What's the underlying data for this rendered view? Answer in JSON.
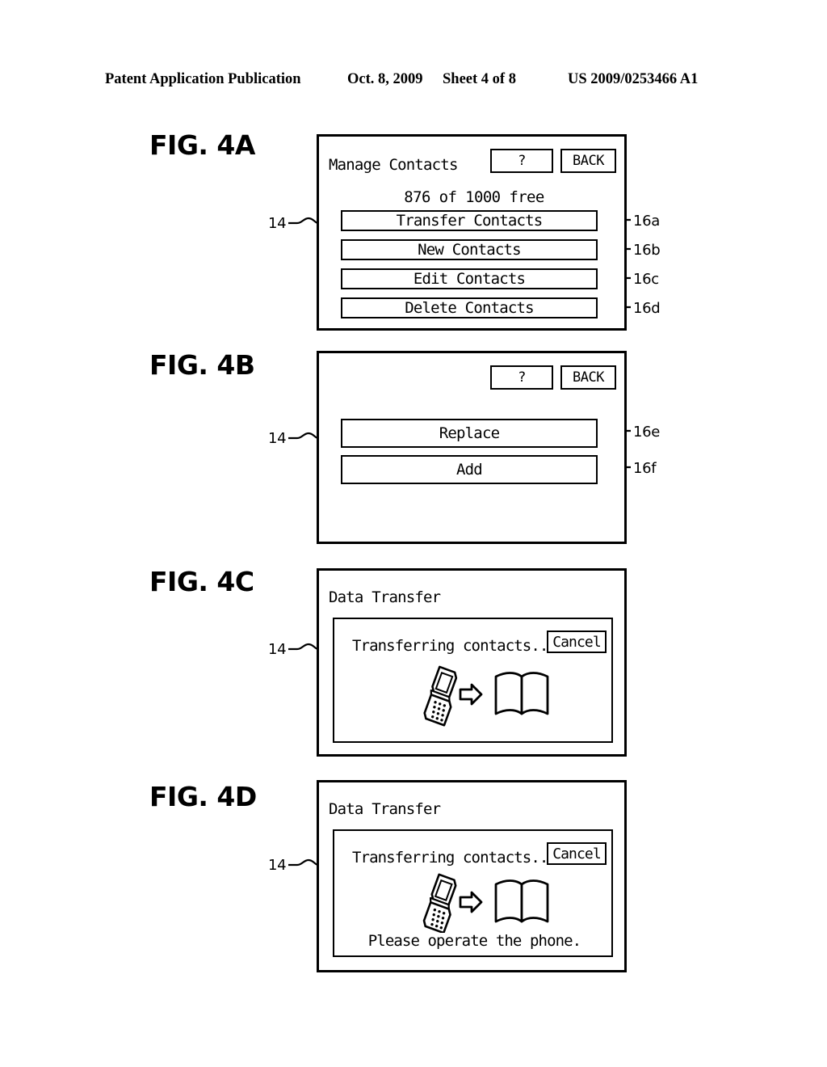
{
  "header": {
    "publication": "Patent Application Publication",
    "date": "Oct. 8, 2009",
    "sheet": "Sheet 4 of 8",
    "patent_number": "US 2009/0253466 A1"
  },
  "figures": [
    {
      "label": "FIG. 4A",
      "screen_ref": "14",
      "title": "Manage Contacts",
      "help_button": "?",
      "back_button": "BACK",
      "free_line": "876 of 1000 free",
      "buttons": [
        {
          "label": "Transfer Contacts",
          "ref": "16a"
        },
        {
          "label": "New Contacts",
          "ref": "16b"
        },
        {
          "label": "Edit Contacts",
          "ref": "16c"
        },
        {
          "label": "Delete Contacts",
          "ref": "16d"
        }
      ]
    },
    {
      "label": "FIG. 4B",
      "screen_ref": "14",
      "help_button": "?",
      "back_button": "BACK",
      "buttons": [
        {
          "label": "Replace",
          "ref": "16e"
        },
        {
          "label": "Add",
          "ref": "16f"
        }
      ]
    },
    {
      "label": "FIG. 4C",
      "screen_ref": "14",
      "title": "Data Transfer",
      "status_text": "Transferring contacts...",
      "cancel_button": "Cancel",
      "icons": [
        "flip-phone-icon",
        "right-arrow-icon",
        "open-book-icon"
      ]
    },
    {
      "label": "FIG. 4D",
      "screen_ref": "14",
      "title": "Data Transfer",
      "status_text": "Transferring contacts...",
      "cancel_button": "Cancel",
      "icons": [
        "flip-phone-icon",
        "right-arrow-icon",
        "open-book-icon"
      ],
      "note": "Please operate the phone."
    }
  ],
  "style": {
    "ink": "#000000",
    "paper": "#ffffff"
  }
}
